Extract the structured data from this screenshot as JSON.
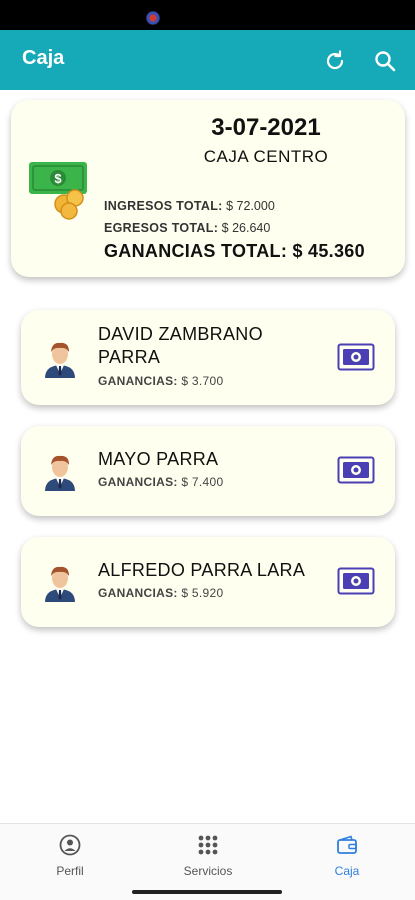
{
  "app_bar": {
    "title": "Caja"
  },
  "summary": {
    "date": "3-07-2021",
    "branch": "CAJA CENTRO",
    "income_label": "INGRESOS TOTAL:",
    "income_value": "$ 72.000",
    "expense_label": "EGRESOS TOTAL:",
    "expense_value": "$ 26.640",
    "profit_label": "GANANCIAS TOTAL:",
    "profit_value": "$ 45.360"
  },
  "employees": [
    {
      "name": "DAVID ZAMBRANO PARRA",
      "earnings_label": "GANANCIAS:",
      "earnings_value": "$ 3.700"
    },
    {
      "name": "MAYO PARRA",
      "earnings_label": "GANANCIAS:",
      "earnings_value": "$ 7.400"
    },
    {
      "name": "ALFREDO PARRA LARA",
      "earnings_label": "GANANCIAS:",
      "earnings_value": "$ 5.920"
    }
  ],
  "bottom_nav": [
    {
      "label": "Perfil",
      "icon": "person-circle-icon",
      "active": false
    },
    {
      "label": "Servicios",
      "icon": "grid-icon",
      "active": false
    },
    {
      "label": "Caja",
      "icon": "wallet-icon",
      "active": true
    }
  ],
  "colors": {
    "primary": "#16a9b7",
    "card": "#fffff0",
    "active_nav": "#2f7fe0",
    "cash_icon": "#4a3fb5"
  },
  "icons": {
    "refresh": "refresh-icon",
    "search": "search-icon",
    "money": "money-icon",
    "cash": "cash-icon",
    "avatar": "man-avatar-icon"
  }
}
